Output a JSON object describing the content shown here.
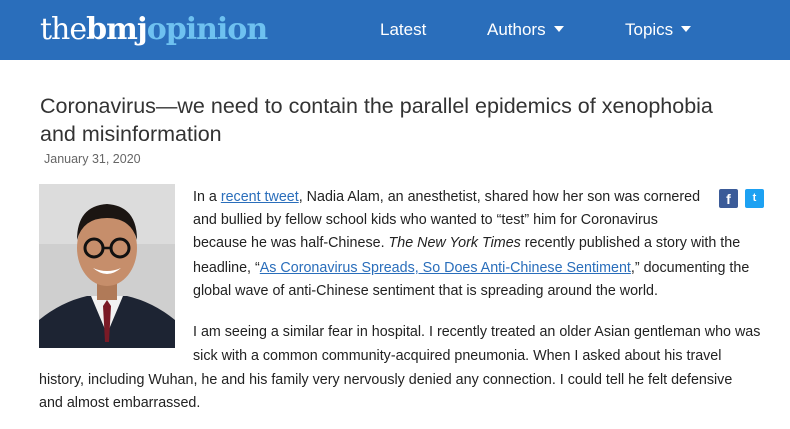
{
  "header": {
    "logo": {
      "part1": "the",
      "part2": "bmj",
      "part3": "opinion"
    },
    "nav": [
      {
        "label": "Latest"
      },
      {
        "label": "Authors"
      },
      {
        "label": "Topics"
      }
    ]
  },
  "colors": {
    "header_bg": "#2a6ebb",
    "link": "#2a6ebb",
    "facebook": "#3b5b98",
    "twitter": "#1da1f2"
  },
  "article": {
    "title_line1": "Coronavirus—we need to contain the parallel epidemics of xenophobia",
    "title_line2": "and misinformation",
    "date": "January 31, 2020",
    "share": {
      "facebook": "f",
      "twitter": "t"
    },
    "para1": {
      "l1_pre": "In a ",
      "l1_link": "recent tweet",
      "l1_post": ", Nadia Alam, an anesthetist, shared how her son was cornered",
      "l2": "and bullied by fellow school kids who wanted to “test” him for Coronavirus",
      "l3_pre": "because he was half-Chinese. ",
      "l3_em": "The New York Times",
      "l3_post": " recently published a story with the",
      "l4_pre": "headline, “",
      "l4_link": "As Coronavirus Spreads, So Does Anti-Chinese Sentiment",
      "l4_post": ",” documenting the",
      "l5": "global wave of anti-Chinese sentiment that is spreading around the world."
    },
    "para2": {
      "l1": "I am seeing a similar fear in hospital. I recently treated an older Asian gentleman who was",
      "l2": "sick with a common community-acquired pneumonia. When I asked about his travel",
      "l3": "history, including Wuhan, he and his family very nervously denied any connection. I could tell he felt defensive",
      "l4": "and almost embarrassed."
    }
  }
}
